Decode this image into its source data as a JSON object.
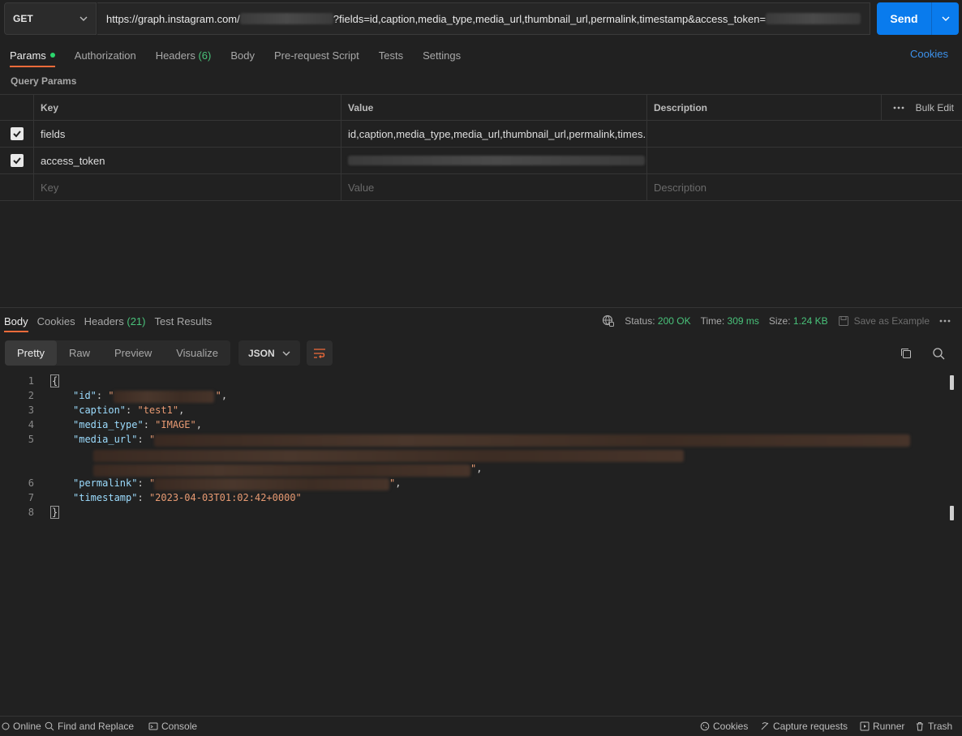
{
  "request": {
    "method": "GET",
    "url_prefix": "https://graph.instagram.com/",
    "url_suffix": "?fields=id,caption,media_type,media_url,thumbnail_url,permalink,timestamp&access_token=",
    "send_label": "Send"
  },
  "request_tabs": [
    {
      "label": "Params"
    },
    {
      "label": "Authorization"
    },
    {
      "label": "Headers",
      "count": "(6)"
    },
    {
      "label": "Body"
    },
    {
      "label": "Pre-request Script"
    },
    {
      "label": "Tests"
    },
    {
      "label": "Settings"
    }
  ],
  "cookies_link": "Cookies",
  "query_params": {
    "title": "Query Params",
    "headers": {
      "key": "Key",
      "value": "Value",
      "description": "Description",
      "bulk_edit": "Bulk Edit"
    },
    "rows": [
      {
        "key": "fields",
        "value": "id,caption,media_type,media_url,thumbnail_url,permalink,times...",
        "checked": true
      },
      {
        "key": "access_token",
        "value": "",
        "checked": true
      }
    ],
    "placeholder": {
      "key": "Key",
      "value": "Value",
      "description": "Description"
    }
  },
  "response_tabs": [
    {
      "label": "Body"
    },
    {
      "label": "Cookies"
    },
    {
      "label": "Headers",
      "count": "(21)"
    },
    {
      "label": "Test Results"
    }
  ],
  "status": {
    "status_label": "Status:",
    "status_value": "200 OK",
    "time_label": "Time:",
    "time_value": "309 ms",
    "size_label": "Size:",
    "size_value": "1.24 KB",
    "save_example": "Save as Example"
  },
  "format": {
    "modes": [
      "Pretty",
      "Raw",
      "Preview",
      "Visualize"
    ],
    "language": "JSON"
  },
  "code": {
    "line_numbers": [
      "1",
      "2",
      "3",
      "4",
      "5",
      "6",
      "7",
      "8"
    ],
    "open_brace": "{",
    "close_brace": "}",
    "id_key": "\"id\"",
    "caption_key": "\"caption\"",
    "caption_val": "\"test1\"",
    "media_type_key": "\"media_type\"",
    "media_type_val": "\"IMAGE\"",
    "media_url_key": "\"media_url\"",
    "permalink_key": "\"permalink\"",
    "timestamp_key": "\"timestamp\"",
    "timestamp_val": "\"2023-04-03T01:02:42+0000\""
  },
  "footer": {
    "online": "Online",
    "find_replace": "Find and Replace",
    "console": "Console",
    "cookies": "Cookies",
    "capture": "Capture requests",
    "runner": "Runner",
    "trash": "Trash"
  },
  "colors": {
    "accent": "#097bed",
    "tab_indicator": "#f26b3a",
    "ok": "#49c27a",
    "link": "#3d92ec"
  }
}
